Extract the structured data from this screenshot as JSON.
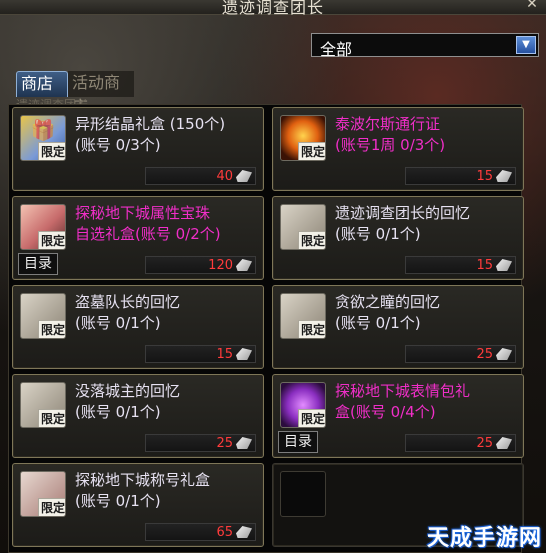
{
  "window": {
    "title": "遗迹调查团长"
  },
  "filter": {
    "value": "全部"
  },
  "tabs": [
    {
      "label": "商店",
      "active": true
    },
    {
      "label": "活动商店",
      "active": false
    }
  ],
  "subtitle": "遗迹调查团长",
  "items": [
    {
      "name": "异形结晶礼盒 (150个)\n(账号 0/3个)",
      "price": "40",
      "badge": "限定",
      "color": "white",
      "icon": "gift-box"
    },
    {
      "name": "泰波尔斯通行证\n(账号1周 0/3个)",
      "price": "15",
      "badge": "限定",
      "color": "magenta",
      "icon": "fire-emblem"
    },
    {
      "name": "探秘地下城属性宝珠\n自选礼盒(账号 0/2个)",
      "price": "120",
      "badge": "限定",
      "color": "magenta",
      "icon": "orb-box",
      "catalog": "目录"
    },
    {
      "name": "遗迹调查团长的回忆\n(账号 0/1个)",
      "price": "15",
      "badge": "限定",
      "color": "white",
      "icon": "memory-card"
    },
    {
      "name": "盗墓队长的回忆\n(账号 0/1个)",
      "price": "15",
      "badge": "限定",
      "color": "white",
      "icon": "memory-card"
    },
    {
      "name": "贪欲之瞳的回忆\n(账号 0/1个)",
      "price": "25",
      "badge": "限定",
      "color": "white",
      "icon": "memory-card"
    },
    {
      "name": "没落城主的回忆\n(账号 0/1个)",
      "price": "25",
      "badge": "限定",
      "color": "white",
      "icon": "memory-card"
    },
    {
      "name": "探秘地下城表情包礼\n盒(账号 0/4个)",
      "price": "25",
      "badge": "限定",
      "color": "magenta",
      "icon": "emote-box",
      "catalog": "目录"
    },
    {
      "name": "探秘地下城称号礼盒\n(账号 0/1个)",
      "price": "65",
      "badge": "限定",
      "color": "white",
      "icon": "title-box"
    }
  ],
  "watermark": "天成手游网",
  "colors": {
    "price": "#ff3b3b",
    "magenta_name": "#f02ec8",
    "white_name": "#e7e2f2"
  }
}
